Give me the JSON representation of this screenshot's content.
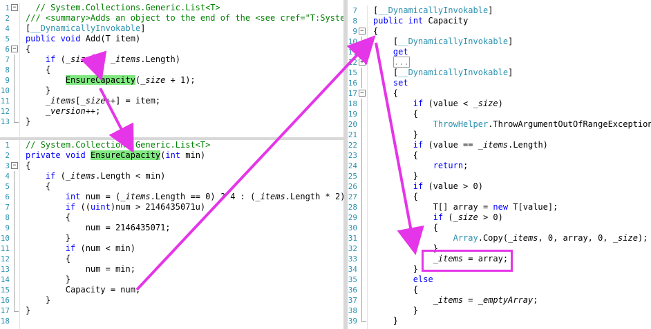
{
  "colors": {
    "keyword": "#0000ff",
    "comment": "#008000",
    "type": "#2b91af",
    "highlight": "#7fe87f",
    "annotation": "#e535e8"
  },
  "panes": {
    "top_left": {
      "lines": [
        {
          "n": "1",
          "t": [
            [
              "  // System.Collections.Generic.List<T>",
              "cm"
            ]
          ]
        },
        {
          "n": "2",
          "t": [
            [
              "/// <summary>Adds an object to the end of the <see cref=\"T:System",
              "cm"
            ]
          ]
        },
        {
          "n": "4",
          "t": [
            [
              "[",
              "p"
            ],
            [
              "__DynamicallyInvokable",
              "ty"
            ],
            [
              "]",
              "p"
            ]
          ]
        },
        {
          "n": "5",
          "t": [
            [
              "public",
              "kw"
            ],
            [
              " ",
              "p"
            ],
            [
              "void",
              "kw"
            ],
            [
              " Add",
              "p"
            ],
            [
              "(",
              "p"
            ],
            [
              "T item",
              "p"
            ],
            [
              ")",
              "p"
            ]
          ]
        },
        {
          "n": "6",
          "t": [
            [
              "{",
              "p"
            ]
          ]
        },
        {
          "n": "7",
          "t": [
            [
              "    if",
              "kw"
            ],
            [
              " (",
              "p"
            ],
            [
              "_size",
              "fld"
            ],
            [
              " == ",
              "p"
            ],
            [
              "_items",
              "fld"
            ],
            [
              ".Length)",
              "p"
            ]
          ]
        },
        {
          "n": "8",
          "t": [
            [
              "    {",
              "p"
            ]
          ]
        },
        {
          "n": "9",
          "t": [
            [
              "        ",
              "p"
            ],
            [
              "EnsureCapacity",
              "hl"
            ],
            [
              "(",
              "p"
            ],
            [
              "_size",
              "fld"
            ],
            [
              " + 1);",
              "p"
            ]
          ]
        },
        {
          "n": "10",
          "t": [
            [
              "    }",
              "p"
            ]
          ]
        },
        {
          "n": "11",
          "t": [
            [
              "    ",
              "p"
            ],
            [
              "_items",
              "fld"
            ],
            [
              "[",
              "p"
            ],
            [
              "_size",
              "fld"
            ],
            [
              "++] = item;",
              "p"
            ]
          ]
        },
        {
          "n": "12",
          "t": [
            [
              "    ",
              "p"
            ],
            [
              "_version",
              "fld"
            ],
            [
              "++;",
              "p"
            ]
          ]
        },
        {
          "n": "13",
          "t": [
            [
              "}",
              "p"
            ]
          ]
        }
      ]
    },
    "bottom_left": {
      "lines": [
        {
          "n": "1",
          "t": [
            [
              "// System.Collections.Generic.List<T>",
              "cm"
            ]
          ]
        },
        {
          "n": "2",
          "t": [
            [
              "private",
              "kw"
            ],
            [
              " ",
              "p"
            ],
            [
              "void",
              "kw"
            ],
            [
              " ",
              "p"
            ],
            [
              "EnsureCapacity",
              "hl"
            ],
            [
              "(",
              "p"
            ],
            [
              "int",
              "kw"
            ],
            [
              " min)",
              "p"
            ]
          ]
        },
        {
          "n": "3",
          "t": [
            [
              "{",
              "p"
            ]
          ]
        },
        {
          "n": "4",
          "t": [
            [
              "    if",
              "kw"
            ],
            [
              " (",
              "p"
            ],
            [
              "_items",
              "fld"
            ],
            [
              ".Length < min)",
              "p"
            ]
          ]
        },
        {
          "n": "5",
          "t": [
            [
              "    {",
              "p"
            ]
          ]
        },
        {
          "n": "6",
          "t": [
            [
              "        ",
              "p"
            ],
            [
              "int",
              "kw"
            ],
            [
              " num = (",
              "p"
            ],
            [
              "_items",
              "fld"
            ],
            [
              ".Length == 0) ? 4 : (",
              "p"
            ],
            [
              "_items",
              "fld"
            ],
            [
              ".Length * 2);",
              "p"
            ]
          ]
        },
        {
          "n": "7",
          "t": [
            [
              "        ",
              "p"
            ],
            [
              "if",
              "kw"
            ],
            [
              " ((",
              "p"
            ],
            [
              "uint",
              "kw"
            ],
            [
              ")num > 2146435071u)",
              "p"
            ]
          ]
        },
        {
          "n": "8",
          "t": [
            [
              "        {",
              "p"
            ]
          ]
        },
        {
          "n": "9",
          "t": [
            [
              "            num = 2146435071;",
              "p"
            ]
          ]
        },
        {
          "n": "10",
          "t": [
            [
              "        }",
              "p"
            ]
          ]
        },
        {
          "n": "11",
          "t": [
            [
              "        ",
              "p"
            ],
            [
              "if",
              "kw"
            ],
            [
              " (num < min)",
              "p"
            ]
          ]
        },
        {
          "n": "12",
          "t": [
            [
              "        {",
              "p"
            ]
          ]
        },
        {
          "n": "13",
          "t": [
            [
              "            num = min;",
              "p"
            ]
          ]
        },
        {
          "n": "14",
          "t": [
            [
              "        }",
              "p"
            ]
          ]
        },
        {
          "n": "15",
          "t": [
            [
              "        Capacity = num;",
              "p"
            ]
          ]
        },
        {
          "n": "16",
          "t": [
            [
              "    }",
              "p"
            ]
          ]
        },
        {
          "n": "17",
          "t": [
            [
              "}",
              "p"
            ]
          ]
        },
        {
          "n": "18",
          "t": [
            [
              "",
              "p"
            ]
          ]
        }
      ]
    },
    "right": {
      "lines": [
        {
          "n": "7",
          "t": [
            [
              "[",
              "p"
            ],
            [
              "__DynamicallyInvokable",
              "ty"
            ],
            [
              "]",
              "p"
            ]
          ]
        },
        {
          "n": "8",
          "t": [
            [
              "public",
              "kw"
            ],
            [
              " ",
              "p"
            ],
            [
              "int",
              "kw"
            ],
            [
              " Capacity",
              "p"
            ]
          ]
        },
        {
          "n": "9",
          "t": [
            [
              "{",
              "p"
            ]
          ]
        },
        {
          "n": "10",
          "t": [
            [
              "    [",
              "p"
            ],
            [
              "__DynamicallyInvokable",
              "ty"
            ],
            [
              "]",
              "p"
            ]
          ]
        },
        {
          "n": "11",
          "t": [
            [
              "    get",
              "kw"
            ]
          ]
        },
        {
          "n": "12",
          "t": [
            [
              "    ",
              "p"
            ],
            [
              "...",
              "bx"
            ]
          ]
        },
        {
          "n": "15",
          "t": [
            [
              "    [",
              "p"
            ],
            [
              "__DynamicallyInvokable",
              "ty"
            ],
            [
              "]",
              "p"
            ]
          ]
        },
        {
          "n": "16",
          "t": [
            [
              "    set",
              "kw"
            ]
          ]
        },
        {
          "n": "17",
          "t": [
            [
              "    {",
              "p"
            ]
          ]
        },
        {
          "n": "18",
          "t": [
            [
              "        if",
              "kw"
            ],
            [
              " (value < ",
              "p"
            ],
            [
              "_size",
              "fld"
            ],
            [
              ")",
              "p"
            ]
          ]
        },
        {
          "n": "19",
          "t": [
            [
              "        {",
              "p"
            ]
          ]
        },
        {
          "n": "20",
          "t": [
            [
              "            ",
              "p"
            ],
            [
              "ThrowHelper",
              "ty"
            ],
            [
              ".ThrowArgumentOutOfRangeException(E",
              "p"
            ]
          ]
        },
        {
          "n": "21",
          "t": [
            [
              "        }",
              "p"
            ]
          ]
        },
        {
          "n": "22",
          "t": [
            [
              "        if",
              "kw"
            ],
            [
              " (value == ",
              "p"
            ],
            [
              "_items",
              "fld"
            ],
            [
              ".Length)",
              "p"
            ]
          ]
        },
        {
          "n": "23",
          "t": [
            [
              "        {",
              "p"
            ]
          ]
        },
        {
          "n": "24",
          "t": [
            [
              "            ",
              "p"
            ],
            [
              "return",
              "kw"
            ],
            [
              ";",
              "p"
            ]
          ]
        },
        {
          "n": "25",
          "t": [
            [
              "        }",
              "p"
            ]
          ]
        },
        {
          "n": "26",
          "t": [
            [
              "        if",
              "kw"
            ],
            [
              " (value > 0)",
              "p"
            ]
          ]
        },
        {
          "n": "27",
          "t": [
            [
              "        {",
              "p"
            ]
          ]
        },
        {
          "n": "28",
          "t": [
            [
              "            T[] array = ",
              "p"
            ],
            [
              "new",
              "kw"
            ],
            [
              " T[value];",
              "p"
            ]
          ]
        },
        {
          "n": "29",
          "t": [
            [
              "            ",
              "p"
            ],
            [
              "if",
              "kw"
            ],
            [
              " (",
              "p"
            ],
            [
              "_size",
              "fld"
            ],
            [
              " > 0)",
              "p"
            ]
          ]
        },
        {
          "n": "30",
          "t": [
            [
              "            {",
              "p"
            ]
          ]
        },
        {
          "n": "31",
          "t": [
            [
              "                ",
              "p"
            ],
            [
              "Array",
              "ty"
            ],
            [
              ".Copy(",
              "p"
            ],
            [
              "_items",
              "fld"
            ],
            [
              ", 0, array, 0, ",
              "p"
            ],
            [
              "_size",
              "fld"
            ],
            [
              ");",
              "p"
            ]
          ]
        },
        {
          "n": "32",
          "t": [
            [
              "            }",
              "p"
            ]
          ]
        },
        {
          "n": "33",
          "t": [
            [
              "            ",
              "p"
            ],
            [
              "_items",
              "fld"
            ],
            [
              " = array;",
              "p"
            ]
          ]
        },
        {
          "n": "34",
          "t": [
            [
              "        }",
              "p"
            ]
          ]
        },
        {
          "n": "35",
          "t": [
            [
              "        else",
              "kw"
            ]
          ]
        },
        {
          "n": "36",
          "t": [
            [
              "        {",
              "p"
            ]
          ]
        },
        {
          "n": "37",
          "t": [
            [
              "            ",
              "p"
            ],
            [
              "_items",
              "fld"
            ],
            [
              " = ",
              "p"
            ],
            [
              "_emptyArray",
              "fld"
            ],
            [
              ";",
              "p"
            ]
          ]
        },
        {
          "n": "38",
          "t": [
            [
              "        }",
              "p"
            ]
          ]
        },
        {
          "n": "39",
          "t": [
            [
              "    }",
              "p"
            ]
          ]
        }
      ]
    }
  }
}
